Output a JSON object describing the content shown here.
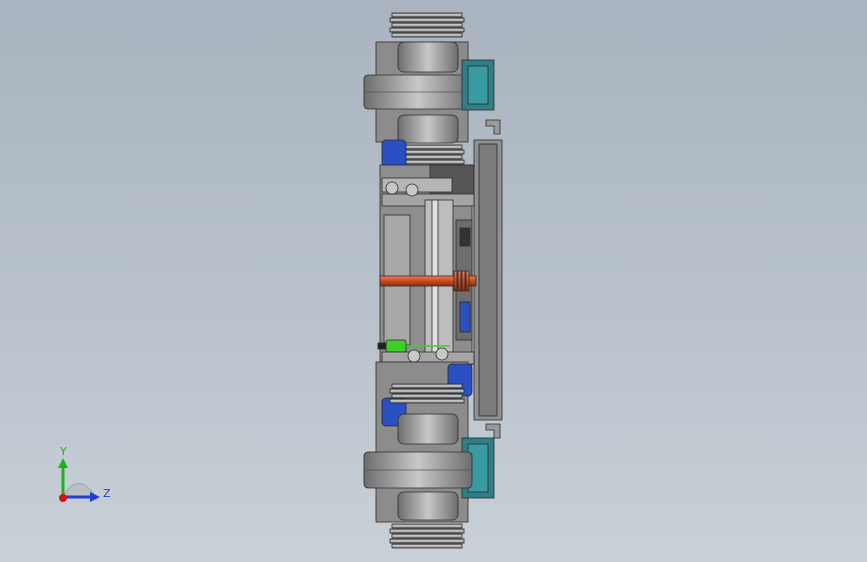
{
  "viewport": {
    "background_top": "#a9b4c0",
    "background_bottom": "#c9d0d7"
  },
  "triad": {
    "y_label": "Y",
    "z_label": "Z",
    "y_color": "#19b31f",
    "z_color": "#1f3fd6",
    "x_color": "#d01414"
  },
  "model": {
    "part_colors": {
      "housing": "#8e8e8e",
      "pulley": "#b0b0b0",
      "motor": "#2a4fc4",
      "teal": "#2f7f86",
      "spring": "#d4552a",
      "sensor": "#3fcf2a"
    }
  }
}
